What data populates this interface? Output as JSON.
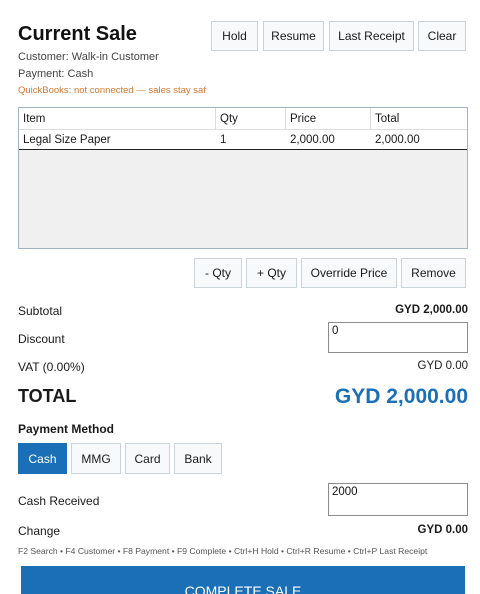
{
  "header": {
    "title": "Current Sale",
    "customer": "Customer: Walk-in Customer",
    "payment": "Payment: Cash",
    "quickbooks_status": "QuickBooks: not connected — sales stay saf"
  },
  "toolbar": {
    "hold": "Hold",
    "resume": "Resume",
    "last_receipt": "Last Receipt",
    "clear": "Clear"
  },
  "grid": {
    "columns": [
      "Item",
      "Qty",
      "Price",
      "Total"
    ],
    "rows": [
      {
        "item": "Legal Size Paper",
        "qty": "1",
        "price": "2,000.00",
        "total": "2,000.00"
      }
    ]
  },
  "line_actions": {
    "minus_qty": "- Qty",
    "plus_qty": "+ Qty",
    "override_price": "Override Price",
    "remove": "Remove"
  },
  "totals": {
    "subtotal_label": "Subtotal",
    "subtotal_value": "GYD 2,000.00",
    "discount_label": "Discount",
    "discount_value": "0",
    "vat_label": "VAT (0.00%)",
    "vat_value": "GYD 0.00",
    "total_label": "TOTAL",
    "total_value": "GYD 2,000.00"
  },
  "payment": {
    "label": "Payment Method",
    "methods": [
      "Cash",
      "MMG",
      "Card",
      "Bank"
    ],
    "selected": "Cash",
    "accent_color": "#1a6fb6",
    "cash_received_label": "Cash Received",
    "cash_received_value": "2000",
    "change_label": "Change",
    "change_value": "GYD 0.00"
  },
  "shortcuts": "F2 Search  •  F4 Customer  •  F8 Payment  •  F9 Complete  •  Ctrl+H Hold  •  Ctrl+R Resume  •  Ctrl+P Last Receipt",
  "complete_button": "Complete Sale"
}
